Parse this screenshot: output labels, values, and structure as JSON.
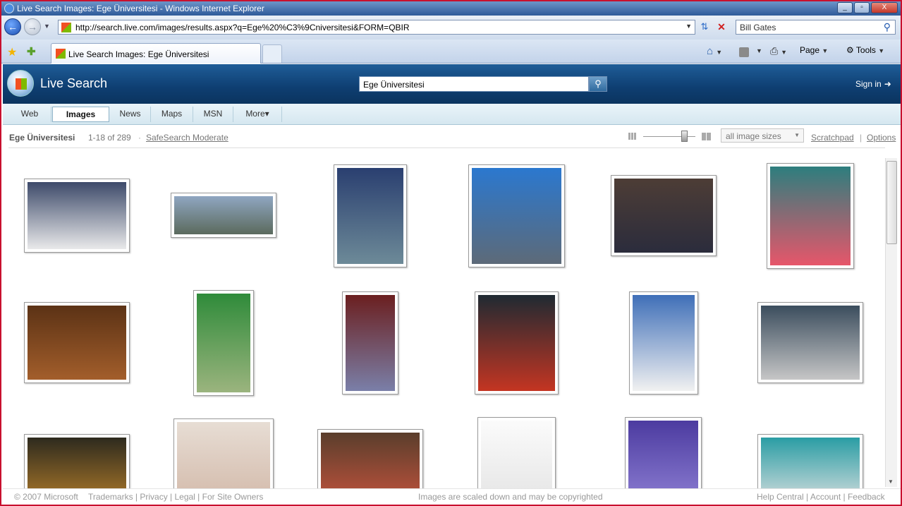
{
  "window": {
    "title": "Live Search Images: Ege Üniversitesi - Windows Internet Explorer",
    "minimize": "_",
    "restore": "▫",
    "close": "X"
  },
  "address_bar": {
    "url": "http://search.live.com/images/results.aspx?q=Ege%20%C3%9Cniversitesi&FORM=QBIR",
    "search_value": "Bill Gates"
  },
  "tab": {
    "title": "Live Search Images: Ege Üniversitesi"
  },
  "command_bar": {
    "page": "Page",
    "tools": "Tools"
  },
  "site": {
    "brand": "Live Search",
    "query": "Ege Üniversitesi",
    "sign_in": "Sign in"
  },
  "nav_tabs": [
    "Web",
    "Images",
    "News",
    "Maps",
    "MSN",
    "More▾"
  ],
  "results": {
    "query_label": "Ege Üniversitesi",
    "count": "1-18 of 289",
    "separator": "·",
    "safesearch": "SafeSearch Moderate",
    "size_filter": "all image sizes",
    "scratchpad": "Scratchpad",
    "pipe": "|",
    "options": "Options"
  },
  "thumbnails": [
    {
      "name": "group-photo-white-coats",
      "color_top": "#3d4a6a",
      "color_bottom": "#e9e9ea"
    },
    {
      "name": "campus-panorama",
      "color_top": "#8fa6c1",
      "color_bottom": "#5b6a5d"
    },
    {
      "name": "conference-poster",
      "color_top": "#2a3f70",
      "color_bottom": "#6d8a98"
    },
    {
      "name": "sailboat-photo",
      "color_top": "#2b78cf",
      "color_bottom": "#5d6a78"
    },
    {
      "name": "women-talking",
      "color_top": "#4d3d36",
      "color_bottom": "#2b2c3c"
    },
    {
      "name": "man-pink-shirt",
      "color_top": "#2d7e7e",
      "color_bottom": "#e7566a"
    },
    {
      "name": "wood-office-room",
      "color_top": "#5b3215",
      "color_bottom": "#a35e2b"
    },
    {
      "name": "green-book-cover",
      "color_top": "#2f8b3a",
      "color_bottom": "#9bb47e"
    },
    {
      "name": "speaker-podium",
      "color_top": "#6b1f1f",
      "color_bottom": "#7a7fa8"
    },
    {
      "name": "man-red-jacket",
      "color_top": "#1f2a32",
      "color_bottom": "#c43522"
    },
    {
      "name": "man-portrait-suit",
      "color_top": "#3f6fb8",
      "color_bottom": "#f1f1f1"
    },
    {
      "name": "group-at-entrance",
      "color_top": "#3b4d5d",
      "color_bottom": "#c6c6c6"
    },
    {
      "name": "tunnel-worker",
      "color_top": "#2d2a1e",
      "color_bottom": "#b77f2a"
    },
    {
      "name": "elderly-man-glasses",
      "color_top": "#e7ddd4",
      "color_bottom": "#d2b8a8"
    },
    {
      "name": "children-reading",
      "color_top": "#5a3e2c",
      "color_bottom": "#c5533d"
    },
    {
      "name": "document-letter",
      "color_top": "#fbfbfb",
      "color_bottom": "#e4e4e4"
    },
    {
      "name": "purple-abstract",
      "color_top": "#4c3ba0",
      "color_bottom": "#8d7fd3"
    },
    {
      "name": "award-ceremony",
      "color_top": "#2a9da4",
      "color_bottom": "#e2e2e2"
    }
  ],
  "footer": {
    "copyright": "© 2007 Microsoft",
    "links_left": "Trademarks | Privacy | Legal | For Site Owners",
    "notice": "Images are scaled down and may be copyrighted",
    "links_right": "Help Central | Account | Feedback"
  }
}
